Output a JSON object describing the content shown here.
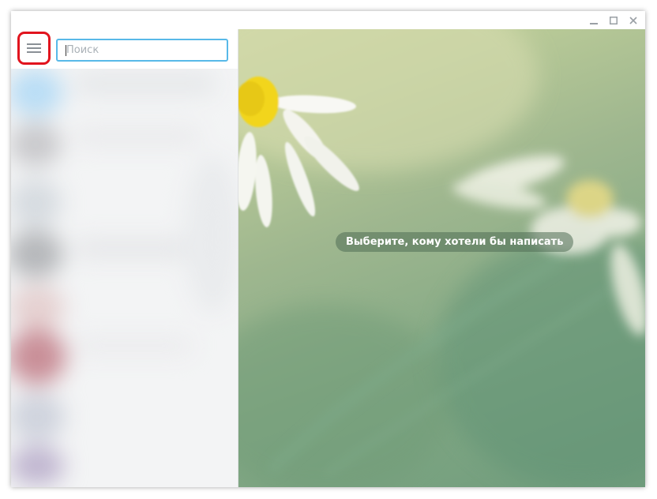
{
  "window_controls": {
    "minimize_icon": "minimize-icon",
    "maximize_icon": "maximize-icon",
    "close_icon": "close-icon"
  },
  "sidebar": {
    "menu_icon": "hamburger-menu-icon",
    "search": {
      "placeholder": "Поиск",
      "value": ""
    }
  },
  "main": {
    "empty_placeholder": "Выберите, кому хотели бы написать"
  },
  "colors": {
    "highlight": "#e1141e",
    "search_focus_border": "#58b9e8",
    "placeholder_pill": "#506e55"
  }
}
